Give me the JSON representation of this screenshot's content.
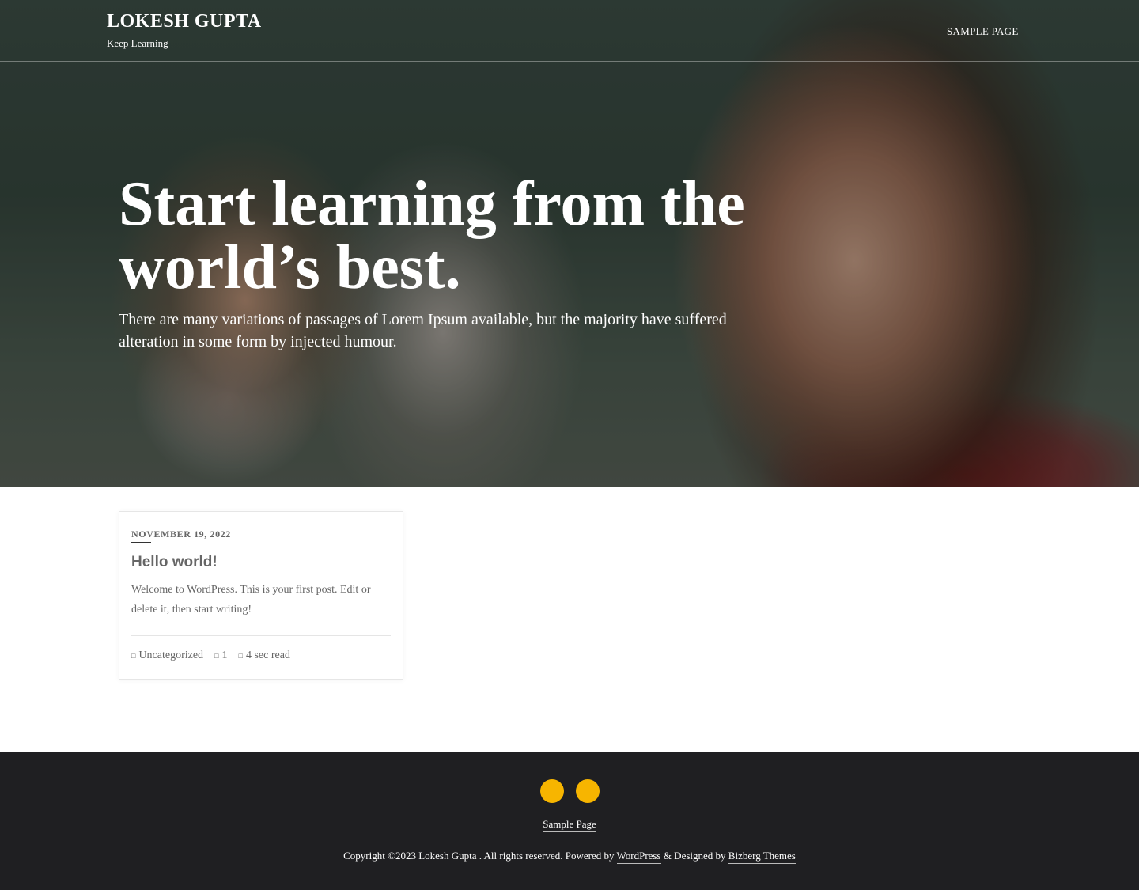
{
  "header": {
    "site_title": "LOKESH GUPTA",
    "tagline": "Keep Learning",
    "nav": [
      "SAMPLE PAGE"
    ]
  },
  "hero": {
    "heading": "Start learning from the world’s best.",
    "subtitle": "There are many variations of passages of Lorem Ipsum available, but the majority have suffered alteration in some form by injected humour."
  },
  "post": {
    "date": "NOVEMBER 19, 2022",
    "title": "Hello world!",
    "excerpt": "Welcome to WordPress. This is your first post. Edit or delete it, then start writing!",
    "category": "Uncategorized",
    "comments": "1",
    "read_time": "4 sec read",
    "icons": {
      "category": "folder-icon",
      "comments": "comment-icon",
      "read_time": "clock-icon"
    }
  },
  "footer": {
    "social": [
      {
        "icon": "social-icon",
        "glyph": ""
      },
      {
        "icon": "social-icon",
        "glyph": ""
      }
    ],
    "nav": [
      "Sample Page"
    ],
    "copyright_pre": "Copyright ©2023 Lokesh Gupta . All rights reserved. Powered by ",
    "wordpress": "WordPress",
    "designed_by": " & Designed by ",
    "theme": "Bizberg Themes"
  },
  "colors": {
    "accent": "#f7b500",
    "footer_bg": "#1f1f22"
  }
}
